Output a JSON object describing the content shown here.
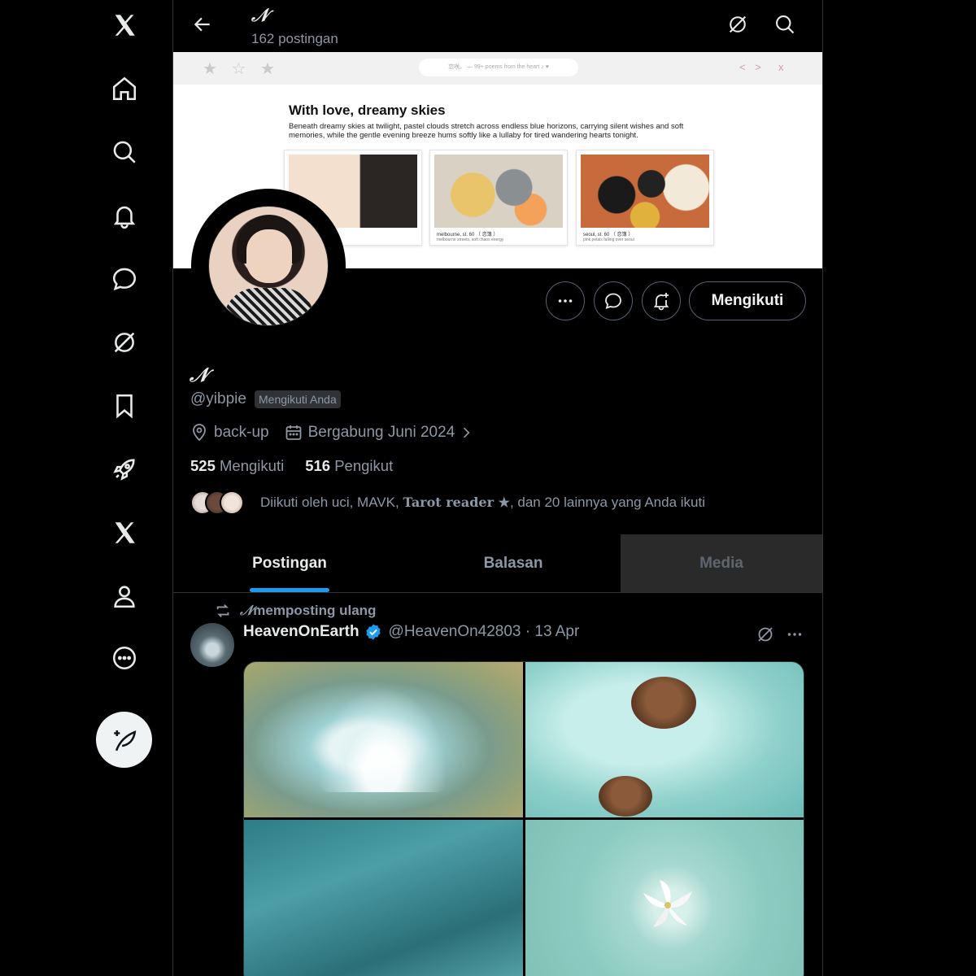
{
  "profile": {
    "display_name": "𝒩",
    "post_count": "162 postingan",
    "handle": "@yibpie",
    "follows_you": "Mengikuti Anda",
    "location": "back-up",
    "joined": "Bergabung Juni 2024",
    "following_count": "525",
    "following_label": "Mengikuti",
    "followers_count": "516",
    "followers_label": "Pengikut",
    "mutuals_prefix": "Diikuti oleh uci, MAVK,",
    "mutuals_special": "Tarot reader ★",
    "mutuals_suffix": ", dan 20 lainnya yang Anda ikuti",
    "follow_button": "Mengikuti"
  },
  "banner": {
    "stars": "★ ☆ ★",
    "url": "恋咲。 — 99+ poems from the heart ♪ ♥",
    "nav": "< >",
    "close": "x",
    "title": "With love, dreamy skies",
    "text": "Beneath dreamy skies at twilight, pastel clouds stretch across endless blue horizons, carrying silent wishes and soft memories, while the gentle evening breeze hums softly like a lullaby for tired wandering hearts tonight.",
    "cards": [
      {
        "caption": "",
        "sub": ""
      },
      {
        "caption": "melbourne, st. 60 （ 恋簿 ）",
        "sub": "melbourne streets, soft chaos energy"
      },
      {
        "caption": "seoul, st. 60 （ 恋簿 ）",
        "sub": "pink petals falling over seoul"
      }
    ]
  },
  "tabs": [
    {
      "label": "Postingan",
      "active": true
    },
    {
      "label": "Balasan",
      "active": false
    },
    {
      "label": "Media",
      "active": false
    }
  ],
  "post": {
    "repost_name": "𝒩",
    "repost_label": "memposting ulang",
    "author": "HeavenOnEarth",
    "handle_date": "@HeavenOn42803 · 13 Apr"
  },
  "colors": {
    "accent": "#1d9bf0",
    "background": "#000000",
    "muted_text": "#8b98a5"
  },
  "icons": {
    "sidebar": [
      "x-logo-icon",
      "home-icon",
      "search-icon",
      "bell-icon",
      "message-icon",
      "grok-icon",
      "bookmark-icon",
      "rocket-icon",
      "x-premium-icon",
      "profile-icon",
      "more-icon",
      "compose-icon"
    ]
  }
}
